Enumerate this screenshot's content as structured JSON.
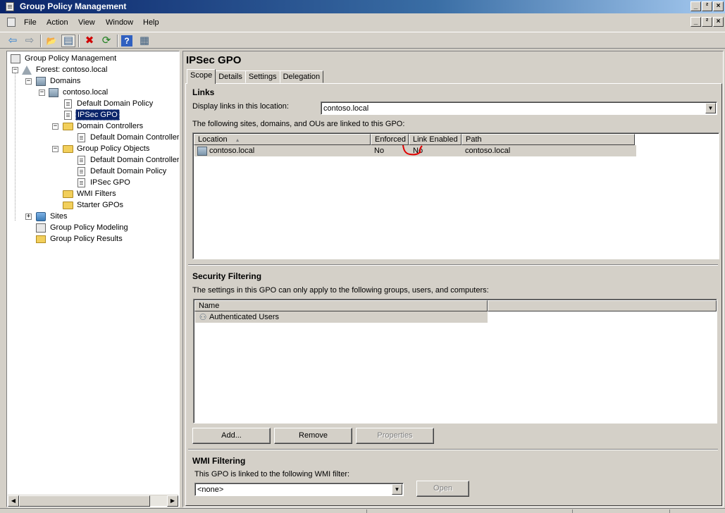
{
  "window": {
    "title": "Group Policy Management",
    "buttons": [
      "_",
      "²",
      "×"
    ]
  },
  "menu": {
    "items": [
      "File",
      "Action",
      "View",
      "Window",
      "Help"
    ],
    "mdi_buttons": [
      "_",
      "²",
      "×"
    ]
  },
  "toolbar": {
    "buttons": [
      "back-icon",
      "forward-icon",
      "up-folder-icon",
      "show-hide-tree-icon",
      "delete-icon",
      "refresh-icon",
      "help-icon",
      "properties-icon"
    ],
    "glyphs": {
      "back": "⇦",
      "forward": "⇨",
      "up": "📂",
      "tree": "▤",
      "delete": "✖",
      "refresh": "⟳",
      "help": "?",
      "props": "▦"
    }
  },
  "tree": {
    "root": "Group Policy Management",
    "forest": "Forest: contoso.local",
    "domains": "Domains",
    "domain": "contoso.local",
    "default_domain_policy": "Default Domain Policy",
    "ipsec_gpo": "IPSec GPO",
    "domain_controllers": "Domain Controllers",
    "default_dc_policy": "Default Domain Controllers",
    "gpo_container": "Group Policy Objects",
    "gpo_items": [
      "Default Domain Controllers",
      "Default Domain Policy",
      "IPSec GPO"
    ],
    "wmi_filters": "WMI Filters",
    "starter_gpos": "Starter GPOs",
    "sites": "Sites",
    "modeling": "Group Policy Modeling",
    "results": "Group Policy Results",
    "expander_minus": "−",
    "expander_plus": "+",
    "scroll_left": "◀",
    "scroll_right": "▶"
  },
  "details": {
    "title": "IPSec GPO",
    "tabs": [
      "Scope",
      "Details",
      "Settings",
      "Delegation"
    ],
    "active_tab": "Scope",
    "links": {
      "heading": "Links",
      "display_label": "Display links in this location:",
      "location_value": "contoso.local",
      "description": "The following sites, domains, and OUs are linked to this GPO:",
      "columns": [
        "Location",
        "Enforced",
        "Link Enabled",
        "Path"
      ],
      "sort_glyph": "▲",
      "rows": [
        {
          "location": "contoso.local",
          "enforced": "No",
          "link_enabled": "No",
          "path": "contoso.local"
        }
      ]
    },
    "security": {
      "heading": "Security Filtering",
      "description": "The settings in this GPO can only apply to the following groups, users, and computers:",
      "columns": [
        "Name"
      ],
      "rows": [
        "Authenticated Users"
      ],
      "buttons": {
        "add": "Add...",
        "remove": "Remove",
        "properties": "Properties"
      }
    },
    "wmi": {
      "heading": "WMI Filtering",
      "description": "This GPO is linked to the following WMI filter:",
      "value": "<none>",
      "open_button": "Open"
    },
    "dropdown_glyph": "▼"
  },
  "colors": {
    "selection": "#0a246a",
    "annotation_red": "#e00000",
    "face": "#d4d0c8"
  }
}
